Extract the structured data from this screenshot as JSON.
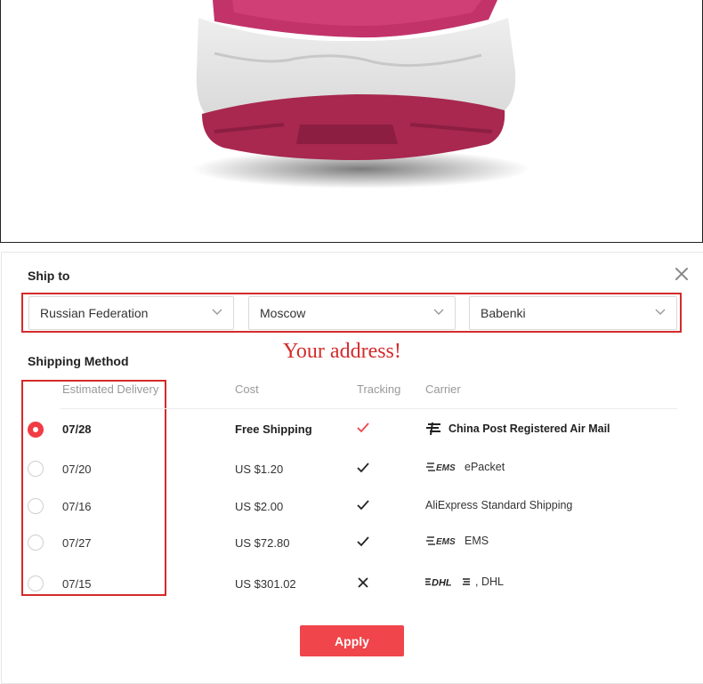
{
  "dialog": {
    "ship_to_title": "Ship to",
    "close_icon": "close-icon",
    "address": {
      "country": "Russian Federation",
      "city": "Moscow",
      "district": "Babenki"
    },
    "annotation": "Your address!",
    "shipping_method_title": "Shipping Method",
    "columns": {
      "delivery": "Estimated Delivery",
      "cost": "Cost",
      "tracking": "Tracking",
      "carrier": "Carrier"
    },
    "rows": [
      {
        "date": "07/28",
        "cost": "Free Shipping",
        "tracking": "yes",
        "carrier_logo": "china-post-logo-icon",
        "carrier": "China Post Registered Air Mail",
        "selected": true
      },
      {
        "date": "07/20",
        "cost": "US $1.20",
        "tracking": "yes",
        "carrier_logo": "ems-logo-icon",
        "carrier": "ePacket",
        "selected": false
      },
      {
        "date": "07/16",
        "cost": "US $2.00",
        "tracking": "yes",
        "carrier_logo": "",
        "carrier": "AliExpress Standard Shipping",
        "selected": false
      },
      {
        "date": "07/27",
        "cost": "US $72.80",
        "tracking": "yes",
        "carrier_logo": "ems-logo-icon",
        "carrier": "EMS",
        "selected": false
      },
      {
        "date": "07/15",
        "cost": "US $301.02",
        "tracking": "no",
        "carrier_logo": "dhl-logo-icon",
        "carrier": ", DHL",
        "selected": false
      }
    ],
    "apply_label": "Apply",
    "colors": {
      "accent": "#f0454a",
      "highlight": "#d42b2b",
      "shoe": "#b83a6a"
    }
  }
}
